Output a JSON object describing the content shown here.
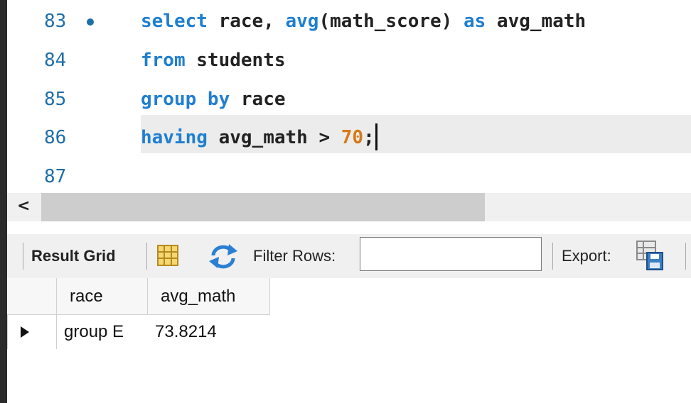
{
  "editor": {
    "lines": [
      {
        "number": "83",
        "breakpoint": true
      },
      {
        "number": "84"
      },
      {
        "number": "85"
      },
      {
        "number": "86"
      },
      {
        "number": "87"
      }
    ],
    "tokens": {
      "l83_kw1": "select",
      "l83_t1": " race, ",
      "l83_fn": "avg",
      "l83_t2": "(math_score) ",
      "l83_kw2": "as",
      "l83_t3": " avg_math",
      "l84_kw": "from",
      "l84_t": " students",
      "l85_kw": "group by",
      "l85_t": " race",
      "l86_kw": "having",
      "l86_t": " avg_math > ",
      "l86_num": "70",
      "l86_end": ";"
    },
    "colors": {
      "keyword": "#1f7fd0",
      "number": "#d87a18",
      "line_number": "#1e6ea8"
    }
  },
  "scrollbar": {
    "left_arrow": "<"
  },
  "toolbar": {
    "result_grid_label": "Result Grid",
    "filter_label": "Filter Rows:",
    "filter_value": "",
    "export_label": "Export:"
  },
  "grid": {
    "columns": [
      "race",
      "avg_math"
    ],
    "rows": [
      {
        "race": "group E",
        "avg_math": "73.8214"
      }
    ]
  }
}
